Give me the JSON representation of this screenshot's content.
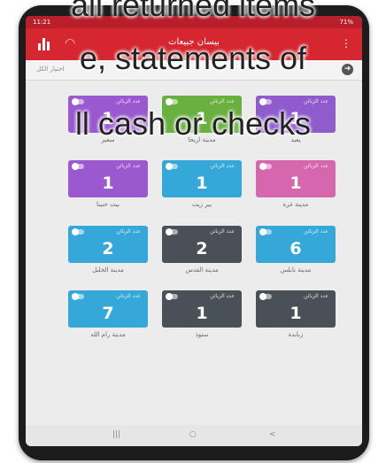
{
  "status_bar": {
    "time": "11:21",
    "battery": "71%"
  },
  "app": {
    "title": "بيسان جبيعات"
  },
  "sub_bar": {
    "tab_label": "اختيار الكل"
  },
  "card_header_label": "عدد الزبائن",
  "cards": [
    {
      "count": "1",
      "name": "يعبد",
      "color": "#8f5bcd"
    },
    {
      "count": "1",
      "name": "مدينة اريحا",
      "color": "#6ab041"
    },
    {
      "count": "1",
      "name": "سعير",
      "color": "#9b59d0"
    },
    {
      "count": "1",
      "name": "مدينة غزة",
      "color": "#d667ae"
    },
    {
      "count": "1",
      "name": "بير زيت",
      "color": "#35a7d8"
    },
    {
      "count": "1",
      "name": "بيت حنينا",
      "color": "#9b59d0"
    },
    {
      "count": "6",
      "name": "مدينة نابلس",
      "color": "#35a7d8"
    },
    {
      "count": "2",
      "name": "مدينة القدس",
      "color": "#4a5058"
    },
    {
      "count": "2",
      "name": "مدينة الخليل",
      "color": "#35a7d8"
    },
    {
      "count": "1",
      "name": "زبابدة",
      "color": "#4a5058"
    },
    {
      "count": "1",
      "name": "ستوذ",
      "color": "#4a5058"
    },
    {
      "count": "7",
      "name": "مدينة رام الله",
      "color": "#35a7d8"
    }
  ],
  "nav": {
    "back": "<",
    "home": "○",
    "recents": "|||"
  },
  "overlay_text": [
    "all returned items",
    "e, statements of",
    "ll cash or checks"
  ]
}
